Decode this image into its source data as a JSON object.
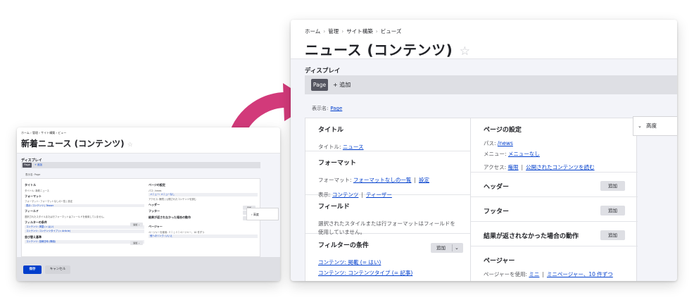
{
  "colors": {
    "accent": "#003ecc",
    "arrow": "#d23a7a",
    "tab_active": "#545560"
  },
  "small": {
    "breadcrumb": "ホーム  ›  管理  ›  サイト構築  ›  ビュー",
    "title": "新着ニュース (コンテンツ)",
    "star": "☆",
    "display_label": "ディスプレイ",
    "tab_page": "Page",
    "tab_add": "+ 追加",
    "display_name": "表示名: Page",
    "left": {
      "title_h": "タイトル",
      "title_val": "タイトル: 新着ニュース",
      "format_h": "フォーマット",
      "format_val": "フォーマット: フォーマットなしの一覧 | 設定",
      "show_val": "表示: コンテンツ | Teaser",
      "fields_h": "フィールド",
      "fields_val": "選択されたスタイルまたは行フォーマットはフィールドを使用していません。",
      "filter_h": "フィルターの条件",
      "filter_1": "コンテンツ: 掲載 (= はい)",
      "filter_2": "コンテンツ: コンテンツタイプ (= Article)",
      "sort_h": "並び替え基準",
      "sort_1": "コンテンツ: 投稿日時 (降順)",
      "add": "追加  ⌄"
    },
    "right": {
      "page_h": "ページの設定",
      "path": "パス: /news",
      "menu": "メニュー: メニューなし",
      "access": "アクセス: 権限 | 公開されたコンテンツを読む",
      "header_h": "ヘッダー",
      "footer_h": "フッター",
      "noresult_h": "結果が返されなかった場合の動作",
      "pager_h": "ページャー",
      "pager_val": "ページャーを使用: ミニ | ミニページャー、10 件ずつ",
      "more_val": "他へのリンク: いいえ",
      "add": "追加"
    },
    "advanced": "› 高度",
    "save": "保存",
    "cancel": "キャンセル"
  },
  "large": {
    "bc_home": "ホーム",
    "bc_admin": "管理",
    "bc_site": "サイト構築",
    "bc_views": "ビューズ",
    "sep": "›",
    "title": "ニュース (コンテンツ)",
    "star": "☆",
    "display_label": "ディスプレイ",
    "tab_page": "Page",
    "tab_add": "+ 追加",
    "display_name_label": "表示名:",
    "display_name_value": "Page",
    "left": {
      "title_h": "タイトル",
      "title_label": "タイトル:",
      "title_value": "ニュース",
      "format_h": "フォーマット",
      "format_label": "フォーマット:",
      "format_value": "フォーマットなしの一覧",
      "format_settings": "設定",
      "show_label": "表示:",
      "show_value1": "コンテンツ",
      "show_value2": "ティーザー",
      "fields_h": "フィールド",
      "fields_text": "選択されたスタイルまたは行フォーマットはフィールドを使用していません。",
      "filter_h": "フィルターの条件",
      "filter_add": "追加",
      "filter_caret": "⌄",
      "filter_1": "コンテンツ: 掲載 (= はい)",
      "filter_2": "コンテンツ: コンテンツタイプ (= 記事)"
    },
    "right": {
      "page_h": "ページの設定",
      "path_label": "パス:",
      "path_value": "/news",
      "menu_label": "メニュー:",
      "menu_value": "メニューなし",
      "access_label": "アクセス:",
      "access_value1": "権限",
      "access_value2": "公開されたコンテンツを読む",
      "header_h": "ヘッダー",
      "footer_h": "フッター",
      "noresult_h": "結果が返されなかった場合の動作",
      "pager_h": "ページャー",
      "pager_label": "ページャーを使用:",
      "pager_value1": "ミニ",
      "pager_value2": "ミニページャー、10 件ずつ",
      "add": "追加"
    },
    "advanced": "高度",
    "advanced_chev": "⌄"
  }
}
